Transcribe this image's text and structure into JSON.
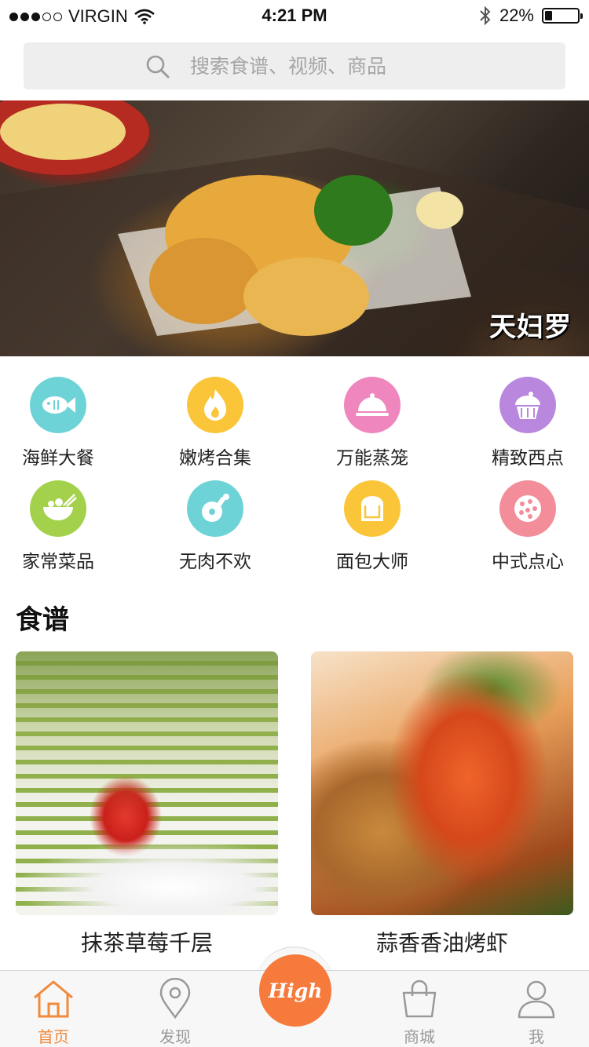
{
  "status_bar": {
    "carrier": "VIRGIN",
    "time": "4:21 PM",
    "battery": "22%",
    "battery_level": 0.22,
    "signal_bars": 2
  },
  "search": {
    "placeholder": "搜索食谱、视频、商品"
  },
  "banner": {
    "caption": "天妇罗"
  },
  "categories": [
    {
      "label": "海鲜大餐",
      "icon": "fish-icon",
      "color": "#6ed3d6"
    },
    {
      "label": "嫩烤合集",
      "icon": "flame-icon",
      "color": "#fbc53a"
    },
    {
      "label": "万能蒸笼",
      "icon": "cloche-icon",
      "color": "#ef86bd"
    },
    {
      "label": "精致西点",
      "icon": "cupcake-icon",
      "color": "#b987dd"
    },
    {
      "label": "家常菜品",
      "icon": "bowl-icon",
      "color": "#a3d14c"
    },
    {
      "label": "无肉不欢",
      "icon": "drumstick-icon",
      "color": "#6ed3d6"
    },
    {
      "label": "面包大师",
      "icon": "bread-icon",
      "color": "#fbc53a"
    },
    {
      "label": "中式点心",
      "icon": "dimsum-icon",
      "color": "#f38d9a"
    }
  ],
  "recipes_section": {
    "title": "食谱",
    "items": [
      {
        "title": "抹茶草莓千层",
        "image": "matcha-crepe-cake-image"
      },
      {
        "title": "蒜香香油烤虾",
        "image": "grilled-shrimp-image"
      }
    ]
  },
  "tab_bar": {
    "tabs": [
      {
        "label": "首页",
        "icon": "home-icon",
        "active": true
      },
      {
        "label": "发现",
        "icon": "location-pin-icon",
        "active": false
      },
      {
        "label": "商城",
        "icon": "shopping-bag-icon",
        "active": false
      },
      {
        "label": "我",
        "icon": "user-icon",
        "active": false
      }
    ],
    "center_button": "High"
  },
  "colors": {
    "accent": "#f57a3b",
    "tab_active": "#f08a3c",
    "tab_inactive": "#999999"
  }
}
